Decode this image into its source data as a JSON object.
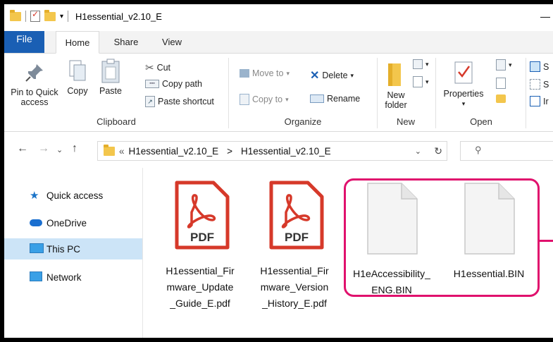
{
  "window": {
    "title": "H1essential_v2.10_E",
    "minimize_glyph": "—"
  },
  "tabs": [
    "File",
    "Home",
    "Share",
    "View"
  ],
  "ribbon": {
    "clipboard": {
      "pin_line1": "Pin to Quick",
      "pin_line2": "access",
      "copy": "Copy",
      "paste": "Paste",
      "cut": "Cut",
      "copy_path": "Copy path",
      "paste_shortcut": "Paste shortcut",
      "label": "Clipboard"
    },
    "organize": {
      "move_to": "Move to",
      "copy_to": "Copy to",
      "delete": "Delete",
      "rename": "Rename",
      "label": "Organize"
    },
    "new": {
      "new_folder_line1": "New",
      "new_folder_line2": "folder",
      "label": "New"
    },
    "open": {
      "properties": "Properties",
      "label": "Open"
    },
    "select": {
      "s1": "S",
      "s2": "S",
      "s3": "Ir"
    }
  },
  "address": {
    "overflow": "«",
    "crumbs": [
      "H1essential_v2.10_E",
      "H1essential_v2.10_E"
    ],
    "separator": ">",
    "search_placeholder": ""
  },
  "navpane": {
    "items": [
      {
        "label": "Quick access",
        "icon": "star-icon"
      },
      {
        "label": "OneDrive",
        "icon": "cloud-icon"
      },
      {
        "label": "This PC",
        "icon": "monitor-icon",
        "selected": true
      },
      {
        "label": "Network",
        "icon": "network-icon"
      }
    ]
  },
  "files": [
    {
      "lines": [
        "H1essential_Fir",
        "mware_Update",
        "_Guide_E.pdf"
      ],
      "type": "pdf",
      "badge": "PDF"
    },
    {
      "lines": [
        "H1essential_Fir",
        "mware_Version",
        "_History_E.pdf"
      ],
      "type": "pdf",
      "badge": "PDF"
    },
    {
      "lines": [
        "H1eAccessibility_",
        "ENG.BIN"
      ],
      "type": "bin"
    },
    {
      "lines": [
        "H1essential.BIN"
      ],
      "type": "bin"
    }
  ],
  "colors": {
    "accent": "#1a5fb4",
    "highlight": "#e0116d",
    "pdf_red": "#d6392a",
    "selection": "#cce4f7"
  }
}
